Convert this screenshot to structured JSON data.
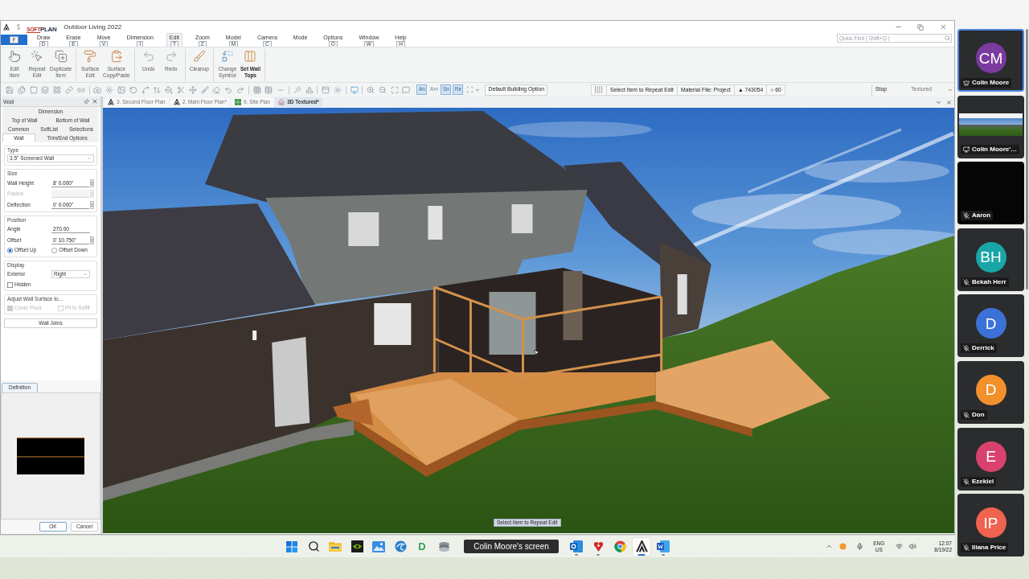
{
  "title_bar": {
    "logo": {
      "prefix": "SOFT",
      "main": "PLAN"
    },
    "title": "Outdoor Living 2022"
  },
  "menu": {
    "file_keytip": "F",
    "tabs": [
      {
        "label": "Draw",
        "keytip": "D",
        "selected": false
      },
      {
        "label": "Erase",
        "keytip": "E",
        "selected": false
      },
      {
        "label": "Move",
        "keytip": "V",
        "selected": false
      },
      {
        "label": "Dimension",
        "keytip": "I",
        "selected": false
      },
      {
        "label": "Edit",
        "keytip": "T",
        "selected": true
      },
      {
        "label": "Zoom",
        "keytip": "Z",
        "selected": false
      },
      {
        "label": "Model",
        "keytip": "M",
        "selected": false
      },
      {
        "label": "Camera",
        "keytip": "C",
        "selected": false
      },
      {
        "label": "Mode",
        "selected": false
      },
      {
        "label": "Options",
        "keytip": "O",
        "selected": false
      },
      {
        "label": "Window",
        "keytip": "W",
        "selected": false
      },
      {
        "label": "Help",
        "keytip": "H",
        "selected": false
      }
    ],
    "quick_find": {
      "placeholder": "Quick Find ( Shift+Q )"
    }
  },
  "ribbon": {
    "groups": [
      {
        "items": [
          {
            "lines": [
              "Edit",
              "Item"
            ],
            "emphasized": false
          },
          {
            "lines": [
              "Repeat",
              "Edit"
            ],
            "emphasized": false
          },
          {
            "lines": [
              "Duplicate",
              "Item"
            ],
            "emphasized": false
          }
        ]
      },
      {
        "items": [
          {
            "lines": [
              "Surface",
              "Edit"
            ],
            "emphasized": false
          },
          {
            "lines": [
              "Surface",
              "Copy/Paste"
            ],
            "emphasized": false
          }
        ]
      },
      {
        "items": [
          {
            "lines": [
              "Undo"
            ],
            "emphasized": false
          },
          {
            "lines": [
              "Redo"
            ],
            "emphasized": false
          }
        ]
      },
      {
        "items": [
          {
            "lines": [
              "Cleanup"
            ],
            "emphasized": false
          }
        ]
      },
      {
        "items": [
          {
            "lines": [
              "Change",
              "Symbol"
            ],
            "emphasized": false
          },
          {
            "lines": [
              "Set Wall",
              "Tops"
            ],
            "emphasized": true
          }
        ]
      }
    ]
  },
  "toolbar": {
    "snap_toggles": [
      {
        "label": "An",
        "on": true
      },
      {
        "label": "Am",
        "on": false
      },
      {
        "label": "Sn",
        "on": true
      },
      {
        "label": "Re",
        "on": true
      }
    ],
    "building_option": "Default Building Option",
    "status_fields": [
      "Select Item to Repeat Edit",
      "Material File: Project",
      "▲ 743054",
      "○ 60"
    ],
    "stop": "Stop",
    "view_mode": "Textured"
  },
  "panel": {
    "title": "Wall",
    "tab_rows": [
      [
        {
          "label": "Dimension",
          "selected": false
        }
      ],
      [
        {
          "label": "Top of Wall",
          "selected": false
        },
        {
          "label": "Bottom of Wall",
          "selected": false
        }
      ],
      [
        {
          "label": "Common",
          "selected": false
        },
        {
          "label": "SoftList",
          "selected": false
        },
        {
          "label": "Selections",
          "selected": false
        }
      ],
      [
        {
          "label": "Wall",
          "selected": true
        },
        {
          "label": "Trim/End Options",
          "selected": false
        }
      ]
    ],
    "groups": [
      {
        "legend": "Type",
        "rows": [
          {
            "kind": "select",
            "value": "3.5\" Screened Wall"
          }
        ]
      },
      {
        "legend": "Size",
        "rows": [
          {
            "kind": "field",
            "label": "Wall Height",
            "value": "8' 0.000\"",
            "disabled": false,
            "spinner": true
          },
          {
            "kind": "field",
            "label": "Radius",
            "disabled": true,
            "spinner": true
          },
          {
            "kind": "field",
            "label": "Deflection",
            "value": "0' 0.000\"",
            "disabled": false,
            "spinner": true
          }
        ]
      },
      {
        "legend": "Position",
        "rows": [
          {
            "kind": "field",
            "label": "Angle",
            "value": "270.00",
            "disabled": false,
            "spinner": false
          },
          {
            "kind": "field",
            "label": "Offset",
            "value": "0' 10.750\"",
            "disabled": false,
            "spinner": true
          },
          {
            "kind": "radios",
            "options": [
              {
                "label": "Offset Up",
                "selected": true
              },
              {
                "label": "Offset Down",
                "selected": false
              }
            ]
          }
        ]
      },
      {
        "legend": "Display",
        "rows": [
          {
            "kind": "labeled_select",
            "label": "Exterior",
            "value": "Right"
          },
          {
            "kind": "checkboxes",
            "options": [
              {
                "label": "Hidden",
                "checked": false,
                "disabled": false
              }
            ]
          }
        ]
      },
      {
        "legend": "Adjust Wall Surface to...",
        "rows": [
          {
            "kind": "checkboxes",
            "options": [
              {
                "label": "Cover Floor",
                "checked": true,
                "disabled": true
              },
              {
                "label": "Fit to Soffit",
                "checked": false,
                "disabled": true
              }
            ]
          }
        ]
      }
    ],
    "joins_button": "Wall Joins",
    "definition_tab": "Definition",
    "buttons": [
      "OK",
      "Cancel"
    ]
  },
  "doc_tabs": [
    {
      "label": "3. Second Floor Plan",
      "kind": "plan",
      "selected": false
    },
    {
      "label": "2. Main Floor Plan*",
      "kind": "plan",
      "selected": false
    },
    {
      "label": "9. Site Plan",
      "kind": "site",
      "selected": false
    },
    {
      "label": "3D Textured*",
      "kind": "render",
      "selected": true
    }
  ],
  "viewport": {
    "hint": "Select Item to Repeat Edit"
  },
  "participants": [
    {
      "name": "Colin Moore",
      "initials": "CM",
      "kind": "avatar",
      "host": true,
      "muted": false,
      "color": "#7b3a9e",
      "active": true
    },
    {
      "name": "Colin Moore'…",
      "kind": "screen",
      "host": false,
      "muted": false,
      "active": false
    },
    {
      "name": "Aaron",
      "kind": "video",
      "host": false,
      "muted": true,
      "active": false
    },
    {
      "name": "Bekah Herr",
      "initials": "BH",
      "kind": "avatar",
      "host": false,
      "muted": true,
      "color": "#19a6a8",
      "active": false
    },
    {
      "name": "Derrick",
      "initials": "D",
      "kind": "avatar",
      "host": false,
      "muted": true,
      "color": "#3c72d8",
      "active": false
    },
    {
      "name": "Don",
      "initials": "D",
      "kind": "avatar",
      "host": false,
      "muted": true,
      "color": "#f2912c",
      "active": false
    },
    {
      "name": "Ezekiel",
      "initials": "E",
      "kind": "avatar",
      "host": false,
      "muted": true,
      "color": "#d9426e",
      "active": false
    },
    {
      "name": "Iliana Price",
      "initials": "IP",
      "kind": "avatar",
      "host": false,
      "muted": true,
      "color": "#ef6350",
      "active": false
    }
  ],
  "taskbar": {
    "items": [
      {
        "kind": "start",
        "running": false,
        "active": false
      },
      {
        "kind": "search",
        "running": false,
        "active": false
      },
      {
        "kind": "files",
        "running": false,
        "active": false
      },
      {
        "kind": "eye",
        "running": false,
        "active": false
      },
      {
        "kind": "photos",
        "running": false,
        "active": false
      },
      {
        "kind": "swirl",
        "running": false,
        "active": false
      },
      {
        "kind": "letter",
        "glyph": "D",
        "running": false,
        "active": false
      },
      {
        "kind": "stack",
        "running": false,
        "active": false
      },
      {
        "kind": "label",
        "label": "Colin Moore's screen"
      },
      {
        "kind": "mail",
        "running": true,
        "active": false
      },
      {
        "kind": "heart",
        "running": true,
        "active": false
      },
      {
        "kind": "browser",
        "running": false,
        "active": false
      },
      {
        "kind": "roof",
        "running": true,
        "active": true
      },
      {
        "kind": "document",
        "running": true,
        "active": false
      }
    ],
    "language": {
      "primary": "ENG",
      "secondary": "US"
    },
    "time": "12:07",
    "date": "8/19/22"
  }
}
